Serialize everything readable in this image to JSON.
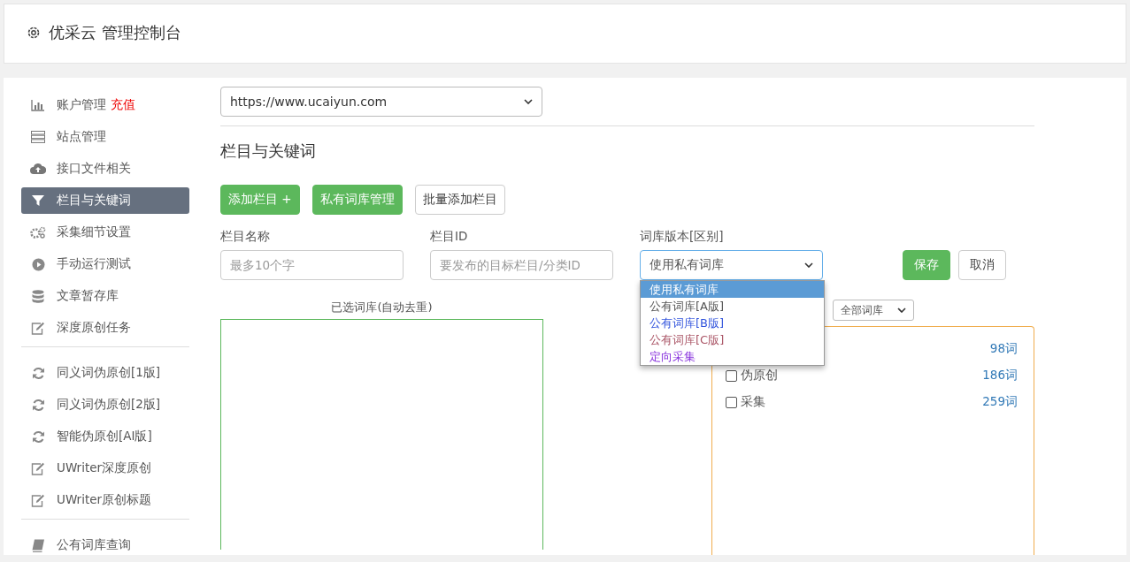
{
  "header": {
    "title": "优采云 管理控制台"
  },
  "sidebar": {
    "groups": [
      {
        "items": [
          {
            "label": "账户管理",
            "badge": "充值",
            "selected": false
          },
          {
            "label": "站点管理",
            "selected": false
          },
          {
            "label": "接口文件相关",
            "selected": false
          },
          {
            "label": "栏目与关键词",
            "selected": true
          },
          {
            "label": "采集细节设置",
            "selected": false
          },
          {
            "label": "手动运行测试",
            "selected": false
          },
          {
            "label": "文章暂存库",
            "selected": false
          },
          {
            "label": "深度原创任务",
            "selected": false
          }
        ]
      },
      {
        "items": [
          {
            "label": "同义词伪原创[1版]",
            "selected": false
          },
          {
            "label": "同义词伪原创[2版]",
            "selected": false
          },
          {
            "label": "智能伪原创[AI版]",
            "selected": false
          },
          {
            "label": "UWriter深度原创",
            "selected": false
          },
          {
            "label": "UWriter原创标题",
            "selected": false
          }
        ]
      },
      {
        "items": [
          {
            "label": "公有词库查询",
            "selected": false
          }
        ]
      }
    ]
  },
  "site_select": {
    "value": "https://www.ucaiyun.com"
  },
  "section_title": "栏目与关键词",
  "toolbar": [
    {
      "label": "添加栏目 +",
      "kind": "primary"
    },
    {
      "label": "私有词库管理",
      "kind": "primary"
    },
    {
      "label": "批量添加栏目",
      "kind": "default"
    }
  ],
  "form": {
    "name_field": {
      "label": "栏目名称",
      "placeholder": "最多10个字"
    },
    "id_field": {
      "label": "栏目ID",
      "placeholder": "要发布的目标栏目/分类ID"
    },
    "version_select": {
      "label": "词库版本[区别]",
      "value": "使用私有词库",
      "expanded": true,
      "options": [
        {
          "label": "使用私有词库",
          "selected": true
        },
        {
          "label": "公有词库[A版]",
          "selected": false,
          "color": "#555555"
        },
        {
          "label": "公有词库[B版]",
          "selected": false,
          "color": "#3355dd"
        },
        {
          "label": "公有词库[C版]",
          "selected": false,
          "color": "#aa5566"
        },
        {
          "label": "定向采集",
          "selected": false,
          "color": "#8833dd"
        }
      ]
    },
    "save_button": "保存",
    "cancel_button": "取消"
  },
  "selected_library": {
    "label": "已选词库(自动去重)"
  },
  "library_filter": {
    "value": "全部词库"
  },
  "library_list": [
    {
      "count": "98词"
    },
    {
      "label": "伪原创",
      "count": "186词",
      "checked": false
    },
    {
      "label": "采集",
      "count": "259词",
      "checked": false
    }
  ]
}
